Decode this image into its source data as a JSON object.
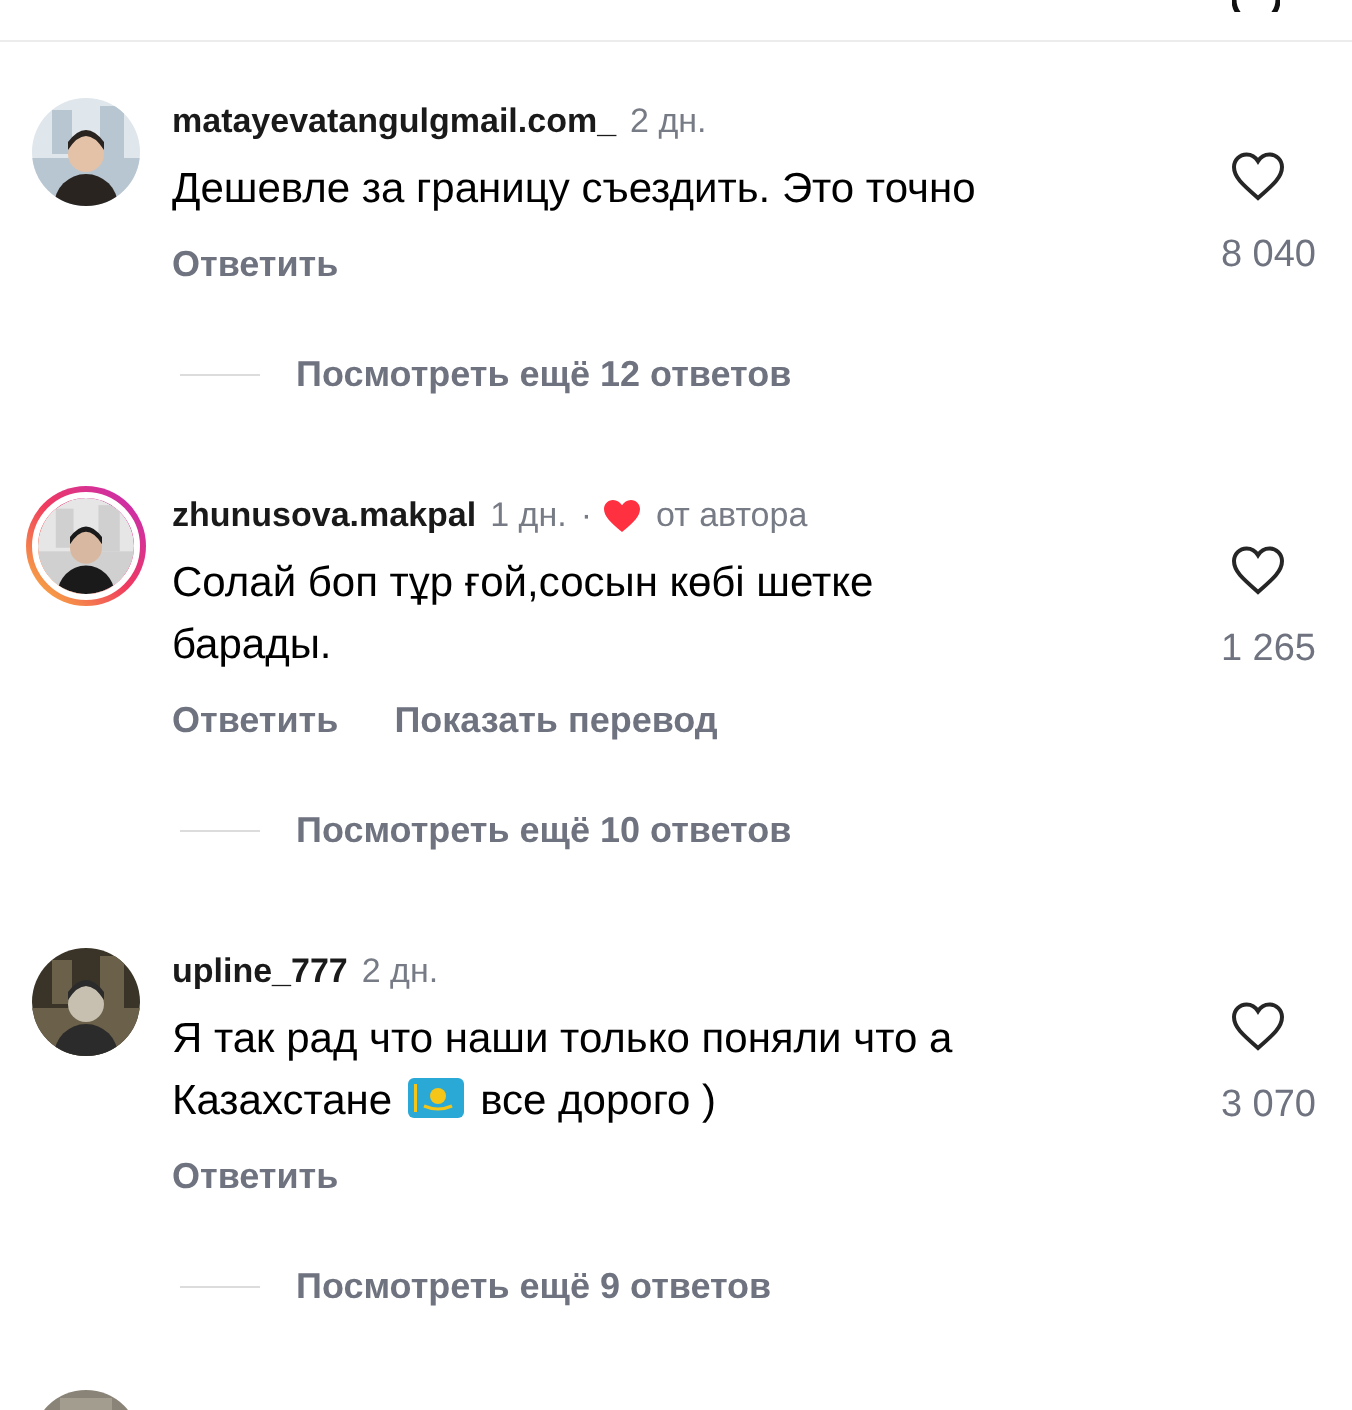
{
  "comments": [
    {
      "username": "matayevatangulgmail.com_",
      "time": "2 дн.",
      "author_liked": false,
      "story_ring": false,
      "avatar": {
        "kind": "picture"
      },
      "segments": [
        {
          "kind": "text",
          "text": "Дешевле за границу съездить. Это точно"
        }
      ],
      "likes": "8 040",
      "actions": [
        "Ответить"
      ],
      "replies": "Посмотреть ещё 12 ответов"
    },
    {
      "username": "zhunusova.makpal",
      "time": "1 дн.",
      "author_liked": true,
      "separator": "·",
      "author_label": "от автора",
      "story_ring": true,
      "avatar": {
        "kind": "picture"
      },
      "segments": [
        {
          "kind": "text",
          "text": "Солай боп тұр ғой,сосын көбі шетке барады."
        }
      ],
      "likes": "1 265",
      "actions": [
        "Ответить",
        "Показать перевод"
      ],
      "replies": "Посмотреть ещё 10 ответов"
    },
    {
      "username": "upline_777",
      "time": "2 дн.",
      "author_liked": false,
      "story_ring": false,
      "avatar": {
        "kind": "picture"
      },
      "segments": [
        {
          "kind": "text",
          "text": "Я так рад что наши только поняли что а"
        },
        {
          "kind": "text",
          "text": "Казахстане"
        },
        {
          "kind": "flag"
        },
        {
          "kind": "text",
          "text": "все дорого )"
        }
      ],
      "likes": "3 070",
      "actions": [
        "Ответить"
      ],
      "replies": "Посмотреть ещё 9 ответов"
    }
  ]
}
